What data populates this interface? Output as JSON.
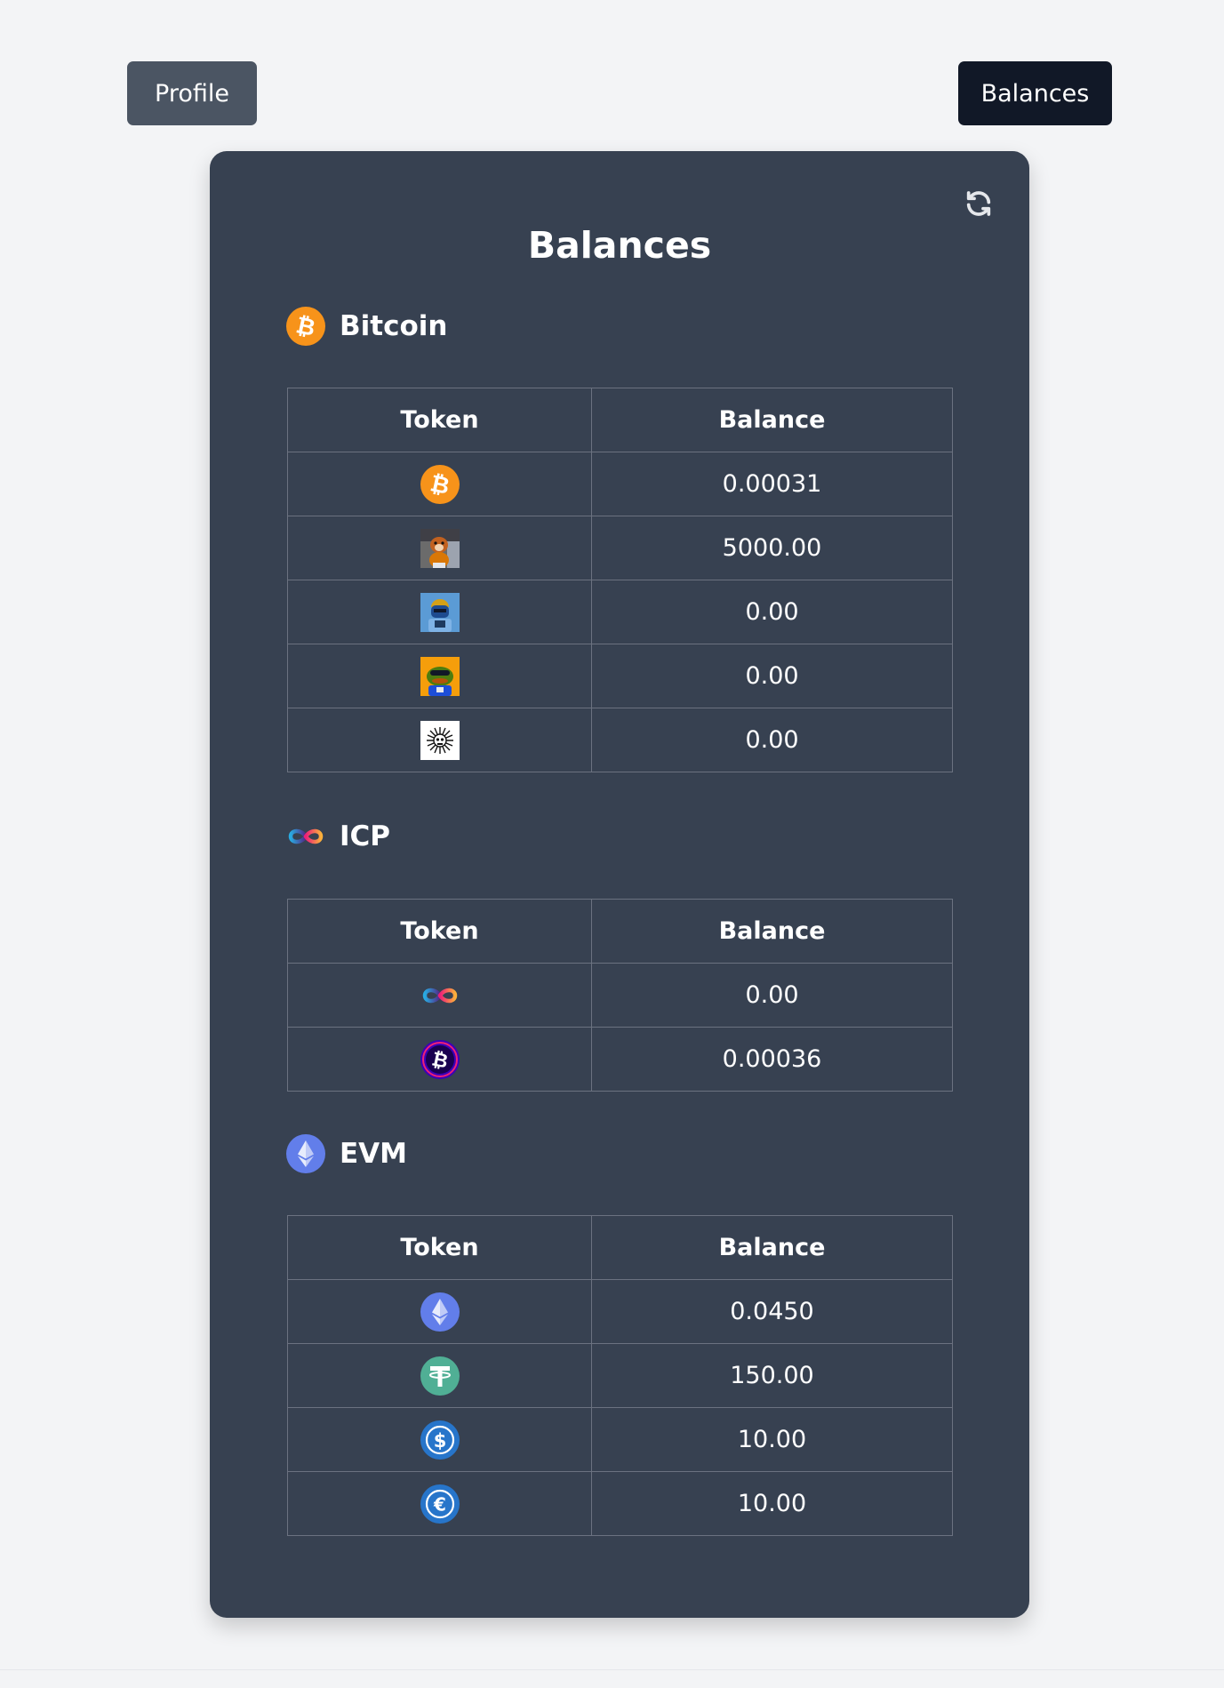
{
  "nav": {
    "profile_label": "Profile",
    "balances_label": "Balances"
  },
  "card": {
    "title": "Balances",
    "refresh_icon": "refresh-icon"
  },
  "sections": {
    "bitcoin": {
      "name": "Bitcoin",
      "icon": "bitcoin-icon",
      "headers": {
        "token": "Token",
        "balance": "Balance"
      },
      "rows": [
        {
          "icon": "bitcoin-icon",
          "balance": "0.00031"
        },
        {
          "icon": "dog-avatar-icon",
          "balance": "5000.00"
        },
        {
          "icon": "blue-character-icon",
          "balance": "0.00"
        },
        {
          "icon": "frog-avatar-icon",
          "balance": "0.00"
        },
        {
          "icon": "sun-skull-icon",
          "balance": "0.00"
        }
      ]
    },
    "icp": {
      "name": "ICP",
      "icon": "infinity-icon",
      "headers": {
        "token": "Token",
        "balance": "Balance"
      },
      "rows": [
        {
          "icon": "infinity-icon",
          "balance": "0.00"
        },
        {
          "icon": "ckbtc-icon",
          "balance": "0.00036"
        }
      ]
    },
    "evm": {
      "name": "EVM",
      "icon": "ethereum-icon",
      "headers": {
        "token": "Token",
        "balance": "Balance"
      },
      "rows": [
        {
          "icon": "ethereum-icon",
          "balance": "0.0450"
        },
        {
          "icon": "tether-icon",
          "balance": "150.00"
        },
        {
          "icon": "usdc-icon",
          "balance": "10.00"
        },
        {
          "icon": "eurc-icon",
          "balance": "10.00"
        }
      ]
    }
  },
  "colors": {
    "page_bg": "#f3f4f6",
    "card_bg": "#374151",
    "profile_btn": "#4b5563",
    "balances_btn": "#111827",
    "bitcoin": "#f7931a",
    "ethereum": "#627eea",
    "tether": "#50af95",
    "usdc": "#2775ca"
  }
}
